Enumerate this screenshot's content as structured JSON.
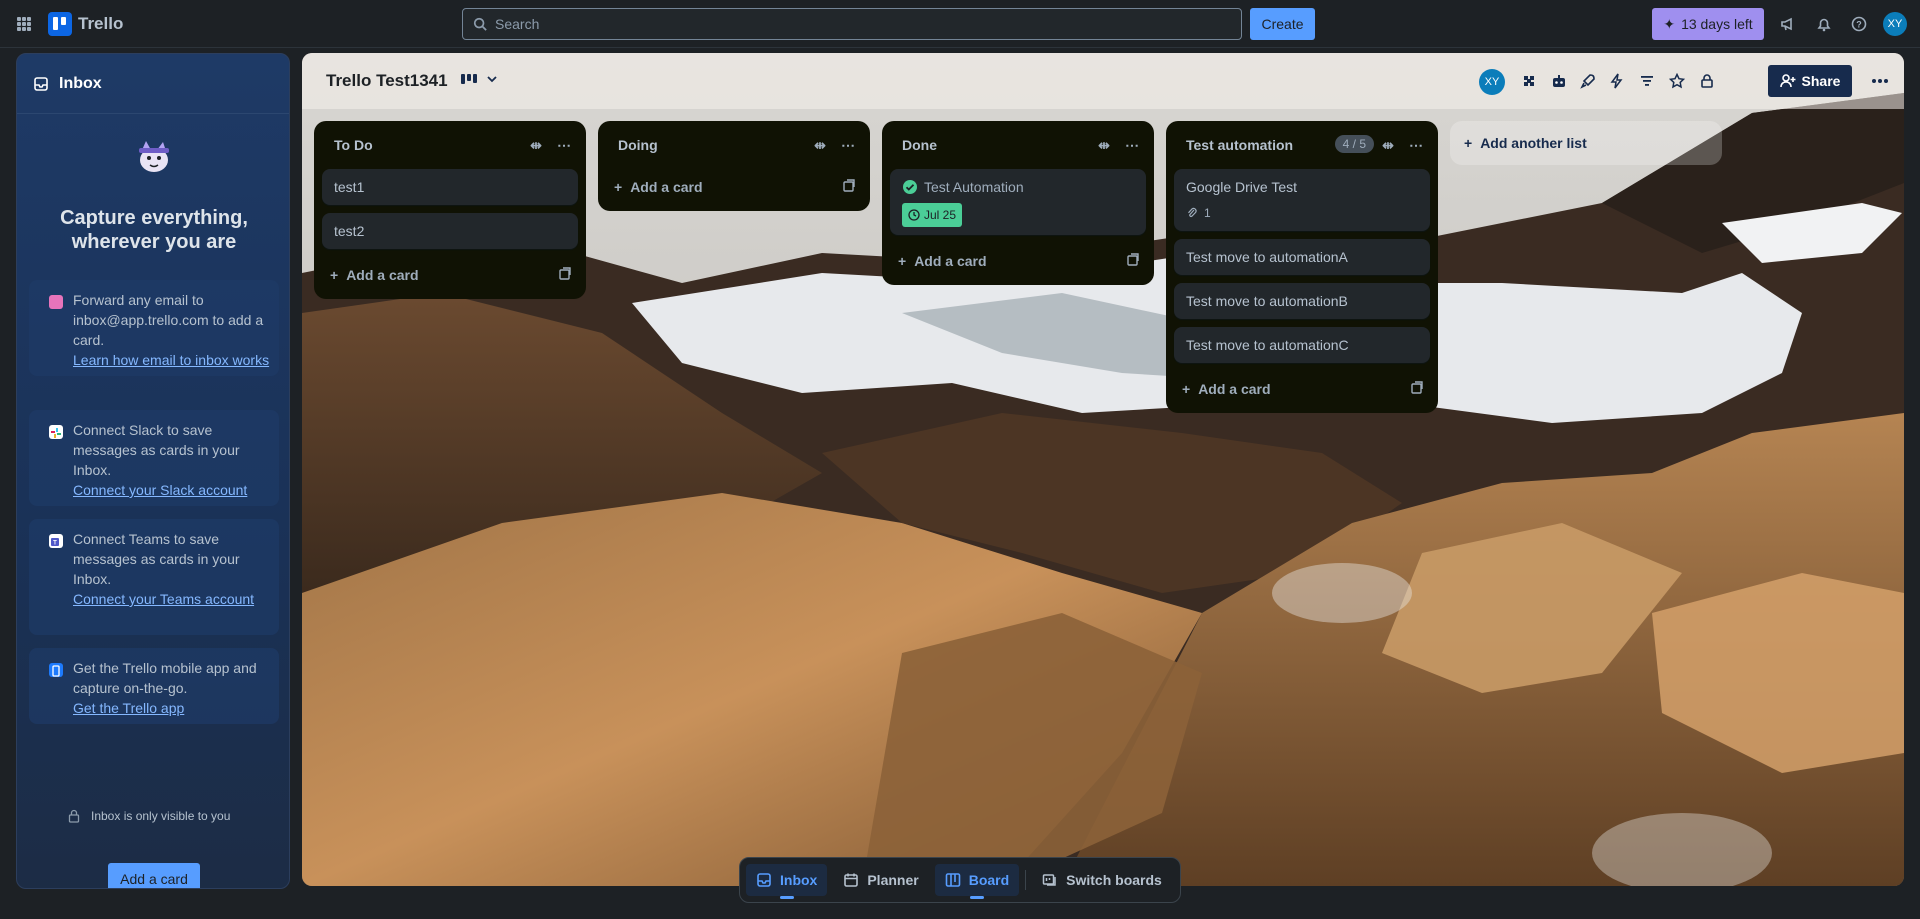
{
  "topbar": {
    "app_name": "Trello",
    "search_placeholder": "Search",
    "create_label": "Create",
    "trial_label": "13 days left",
    "avatar_initials": "XY"
  },
  "inbox": {
    "title": "Inbox",
    "capture_title": "Capture everything, wherever you are",
    "tips": [
      {
        "text": "Forward any email to inbox@app.trello.com to add a card.",
        "link": "Learn how email to inbox works"
      },
      {
        "text": "Connect Slack to save messages as cards in your Inbox.",
        "link": "Connect your Slack account"
      },
      {
        "text": "Connect Teams to save messages as cards in your Inbox.",
        "link": "Connect your Teams account"
      },
      {
        "text": "Get the Trello mobile app and capture on-the-go.",
        "link": "Get the Trello app"
      }
    ],
    "private_note": "Inbox is only visible to you",
    "add_card_label": "Add a card"
  },
  "board": {
    "title": "Trello Test1341",
    "member_initials": "XY",
    "share_label": "Share",
    "add_list_label": "Add another list",
    "lists": [
      {
        "title": "To Do",
        "cards": [
          {
            "title": "test1"
          },
          {
            "title": "test2"
          }
        ],
        "add_label": "Add a card"
      },
      {
        "title": "Doing",
        "cards": [],
        "add_label": "Add a card"
      },
      {
        "title": "Done",
        "cards": [
          {
            "title": "Test Automation",
            "done": true,
            "date": "Jul 25"
          }
        ],
        "add_label": "Add a card"
      },
      {
        "title": "Test automation",
        "count": "4 / 5",
        "cards": [
          {
            "title": "Google Drive Test",
            "attachments": "1"
          },
          {
            "title": "Test move to automationA"
          },
          {
            "title": "Test move to automationB"
          },
          {
            "title": "Test move to automationC"
          }
        ],
        "add_label": "Add a card"
      }
    ]
  },
  "bottom_nav": {
    "inbox": "Inbox",
    "planner": "Planner",
    "board": "Board",
    "switch": "Switch boards"
  },
  "colors": {
    "accent": "#579dff",
    "trial": "#9f8fef",
    "date_badge": "#4bce97"
  }
}
